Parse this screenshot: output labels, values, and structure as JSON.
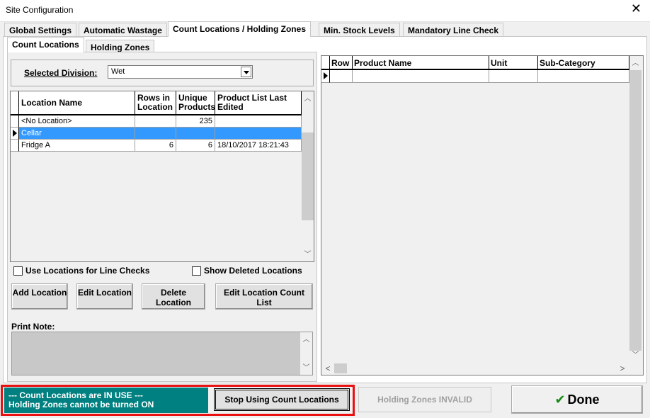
{
  "window": {
    "title": "Site Configuration"
  },
  "tabs": [
    {
      "label": "Global Settings"
    },
    {
      "label": "Automatic Wastage"
    },
    {
      "label": "Count Locations / Holding Zones"
    },
    {
      "label": "Min. Stock Levels"
    },
    {
      "label": "Mandatory Line Check"
    }
  ],
  "subtabs": [
    {
      "label": "Count Locations"
    },
    {
      "label": "Holding Zones"
    }
  ],
  "division": {
    "label": "Selected Division:",
    "value": "Wet"
  },
  "locations_grid": {
    "headers": [
      "Location Name",
      "Rows in Location",
      "Unique Products",
      "Product List Last Edited"
    ],
    "rows": [
      {
        "name": "<No Location>",
        "rows": "",
        "unique": "235",
        "edited": ""
      },
      {
        "name": "Cellar",
        "rows": "",
        "unique": "",
        "edited": ""
      },
      {
        "name": "Fridge A",
        "rows": "6",
        "unique": "6",
        "edited": "18/10/2017 18:21:43"
      }
    ]
  },
  "checkboxes": {
    "line_checks": "Use Locations for Line Checks",
    "show_deleted": "Show Deleted Locations"
  },
  "buttons": {
    "add": "Add Location",
    "edit": "Edit Location",
    "delete": "Delete Location",
    "edit_list": "Edit Location Count List",
    "stop": "Stop Using Count Locations",
    "holding": "Holding Zones INVALID",
    "done": "Done"
  },
  "print_note": {
    "label": "Print Note:"
  },
  "product_grid": {
    "headers": [
      "Row",
      "Product Name",
      "Unit",
      "Sub-Category"
    ]
  },
  "status": {
    "line1": "--- Count Locations are IN USE ---",
    "line2": "Holding Zones cannot be turned ON"
  },
  "colors": {
    "status_bg": "#008080",
    "highlight": "#e81010",
    "selection": "#3399ff",
    "done_check": "#158a15"
  },
  "icons": [
    "close-icon",
    "dropdown-arrow-icon",
    "scroll-up-icon",
    "scroll-down-icon",
    "scroll-left-icon",
    "scroll-right-icon",
    "row-indicator-icon",
    "checkmark-icon"
  ]
}
